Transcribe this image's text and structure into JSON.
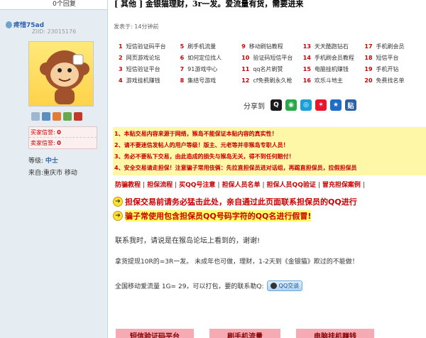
{
  "sidebar": {
    "reply_count": "0个回复",
    "username": "疼惜75ad",
    "uid": "ZiID: 23015176",
    "stats": {
      "buyer_credit_label": "买家信誉:",
      "buyer_credit_value": "0",
      "seller_credit_label": "卖家信誉:",
      "seller_credit_value": "0"
    },
    "level_label": "等级:",
    "level_value": "中士",
    "from_text": "来自:重庆市 移动"
  },
  "post": {
    "title": "[ 其他 ] 金银猫理财，3r一发。爱流量有货，需要进来",
    "posted_time": "发表于: 14分钟前",
    "links": [
      [
        "1",
        "短信验证码平台",
        "5",
        "刷手机流量",
        "9",
        "移动刷钻教程",
        "13",
        "天天酷跑钻石",
        "17",
        "手机刷会员"
      ],
      [
        "2",
        "网页游戏论坛",
        "6",
        "如何定位找人",
        "10",
        "验证码短信平台",
        "14",
        "手机刷会员教程",
        "18",
        "短信平台"
      ],
      [
        "3",
        "短信验证平台",
        "7",
        "91游戏中心",
        "11",
        "qq名片刷赞",
        "15",
        "电脑挂机赚钱",
        "19",
        "手机开钻"
      ],
      [
        "4",
        "游戏挂机赚钱",
        "8",
        "集结号游戏",
        "12",
        "cf免费刷永久枪",
        "16",
        "欢乐斗地主",
        "20",
        "免费找名单"
      ]
    ],
    "share_label": "分享到",
    "notice_lines": [
      "1、本贴交易内容来源于网络，猴岛不能保证本贴内容的真实性！",
      "2、请不要迷信发帖人的用户等级！版主、元老等并非猴岛专职人员！",
      "3、务必不要私下交易，由此造成的损失与猴岛无关，得不到任何赔付！",
      "4、安全交易请走担保！注意骗子常用伎俩：先拉直担保员进对话组，再踢直担保员，拉假担保员"
    ],
    "nav_links": [
      "防骗教程",
      "担保流程",
      "买QQ号注意",
      "担保人员名单",
      "担保人员QQ验证",
      "冒充担保案例"
    ],
    "warn1": "担保交易前请务必猛击此处，亲自通过此页面联系担保员的QQ进行",
    "warn2": "骗子常使用包含担保员QQ号码字符的QQ名进行假冒!",
    "body": {
      "line1": "联系我时，请说是在猴岛论坛上看到的，谢谢!",
      "line2": "拿货提现10R的=3R一发。 未成年也可做，理财，1-2天到《金银猫》欺过的不能做！",
      "line3": "全国移动爱流量 1G= 29，可以打包，要的联系勒Q:",
      "qq_button": "QQ交谈"
    },
    "bottom_buttons": [
      "短信验证码平台",
      "刷手机流量",
      "电脑挂机赚钱"
    ]
  },
  "colors": {
    "sidebar_bg": "#e5edf2",
    "notice_bg": "#fff7a8",
    "warn_red": "#cc0000",
    "link_blue": "#2a5eae"
  }
}
